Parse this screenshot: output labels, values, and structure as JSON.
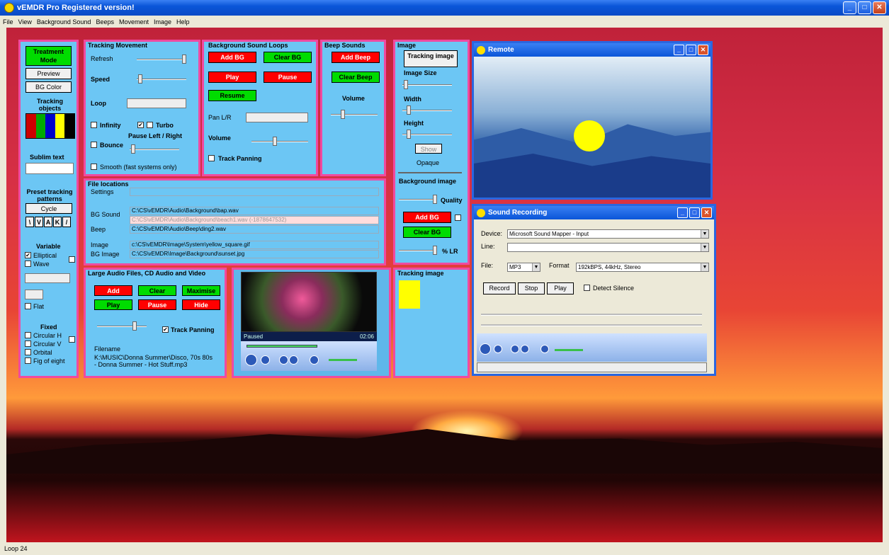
{
  "app": {
    "title": "vEMDR Pro Registered version!"
  },
  "menu": [
    "File",
    "View",
    "Background Sound",
    "Beeps",
    "Movement",
    "Image",
    "Help"
  ],
  "left": {
    "treatment": "Treatment Mode",
    "preview": "Preview",
    "bg_color": "BG Color",
    "tracking_objects": "Tracking objects",
    "sublim_text": "Sublim text",
    "preset": "Preset tracking patterns",
    "cycle": "Cycle",
    "patterns": [
      "\\",
      "V",
      "A",
      "K",
      "/"
    ],
    "variable": "Variable",
    "elliptical": "Elliptical",
    "wave": "Wave",
    "flat": "Flat",
    "fixed": "Fixed",
    "fixed_items": [
      "Circular H",
      "Circular V",
      "Orbital",
      "Fig of eight"
    ]
  },
  "tracking": {
    "title": "Tracking Movement",
    "refresh": "Refresh",
    "speed": "Speed",
    "loop": "Loop",
    "infinity": "Infinity",
    "turbo": "Turbo",
    "bounce": "Bounce",
    "pause_lr": "Pause Left / Right",
    "smooth": "Smooth (fast systems only)"
  },
  "bgloops": {
    "title": "Background Sound Loops",
    "add": "Add BG",
    "clear": "Clear BG",
    "play": "Play",
    "pause": "Pause",
    "resume": "Resume",
    "pan": "Pan L/R",
    "volume": "Volume",
    "track_panning": "Track Panning"
  },
  "beeps": {
    "title": "Beep Sounds",
    "add": "Add Beep",
    "clear": "Clear Beep",
    "volume": "Volume"
  },
  "image": {
    "title": "Image",
    "tracking_image": "Tracking image",
    "size": "Image Size",
    "width": "Width",
    "height": "Height",
    "show": "Show",
    "opaque": "Opaque",
    "bg_image": "Background image",
    "quality": "Quality",
    "add_bg": "Add BG",
    "clear_bg": "Clear BG",
    "lr": "% LR"
  },
  "files": {
    "title": "File locations",
    "settings": "Settings",
    "bg_sound_label": "BG Sound",
    "bg_sound_paths": [
      "C:\\CS\\vEMDR\\Audio\\Background\\bap.wav",
      "C:\\CS\\vEMDR\\Audio\\Background\\beach1.wav (-1878647532)"
    ],
    "beep_label": "Beep",
    "beep": "C:\\CS\\vEMDR\\Audio\\Beep\\ding2.wav",
    "image_label": "Image",
    "image": "c:\\CS\\vEMDR\\Image\\System\\yellow_square.gif",
    "bg_image_label": "BG Image",
    "bg_image": "C:\\CS\\vEMDR\\Image\\Background\\sunset.jpg"
  },
  "large": {
    "title": "Large Audio Files, CD Audio and Video",
    "add": "Add",
    "clear": "Clear",
    "maximise": "Maximise",
    "play": "Play",
    "pause": "Pause",
    "hide": "Hide",
    "track_panning": "Track Panning",
    "filename_label": "Filename",
    "filename": "K:\\MUSIC\\Donna Summer\\Disco, 70s 80s - Donna Summer - Hot Stuff.mp3"
  },
  "player": {
    "status": "Paused",
    "time": "02:06"
  },
  "tracking_image": {
    "title": "Tracking image"
  },
  "remote": {
    "title": "Remote"
  },
  "sound": {
    "title": "Sound Recording",
    "device_label": "Device:",
    "device": "Microsoft Sound Mapper - Input",
    "line_label": "Line:",
    "line": "",
    "file_label": "File:",
    "file": "MP3",
    "format_label": "Format",
    "format": "192kBPS, 44kHz, Stereo",
    "record": "Record",
    "stop": "Stop",
    "play": "Play",
    "detect": "Detect Silence"
  },
  "status": {
    "text": "Loop 24"
  },
  "colors": {
    "panel": "#6cc6f4",
    "border": "#f04aa0",
    "red": "#ff0000",
    "green": "#00dc00",
    "tracking": "#ffff00"
  }
}
